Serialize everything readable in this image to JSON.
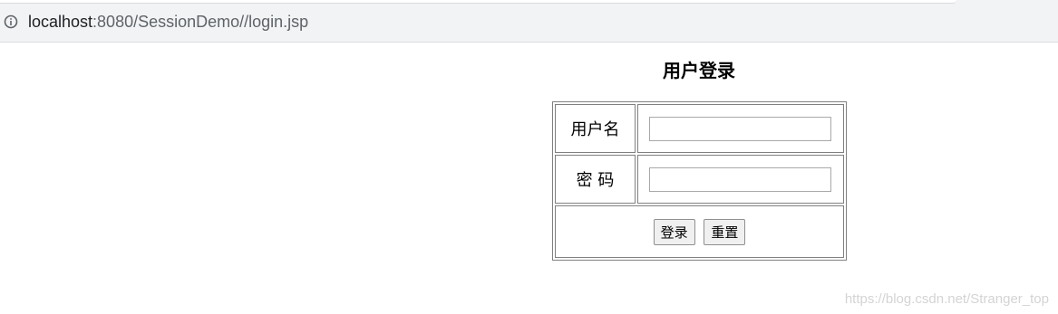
{
  "browser": {
    "url_host": "localhost",
    "url_rest": ":8080/SessionDemo//login.jsp",
    "info_icon": "info-icon"
  },
  "page": {
    "title": "用户登录",
    "form": {
      "username_label": "用户名",
      "username_value": "",
      "password_label": "密 码",
      "password_value": "",
      "login_button": "登录",
      "reset_button": "重置"
    },
    "watermark": "https://blog.csdn.net/Stranger_top"
  }
}
